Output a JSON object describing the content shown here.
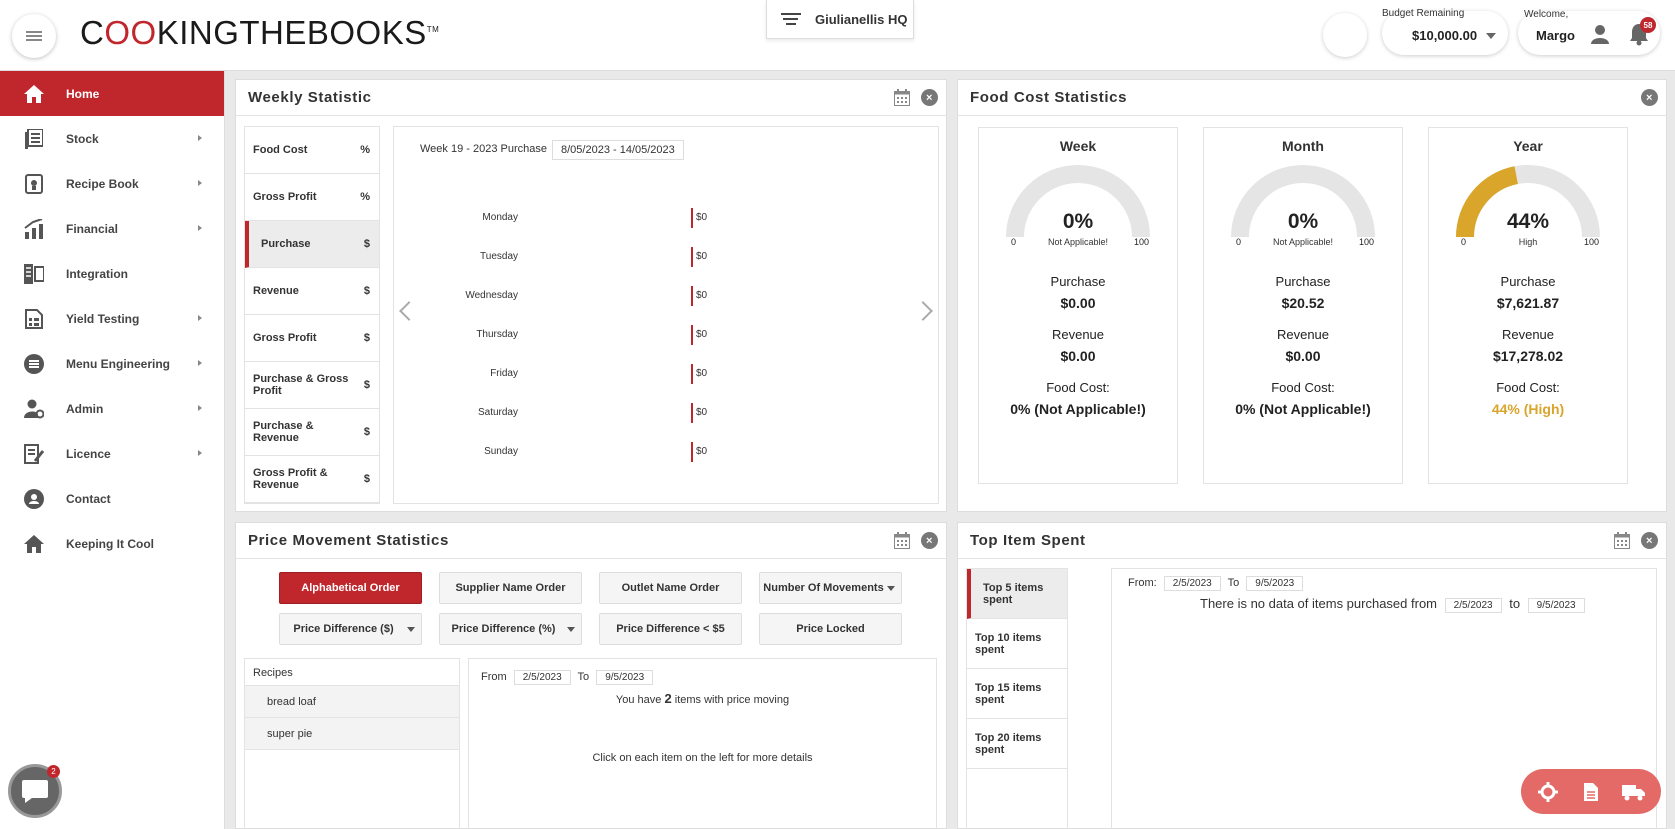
{
  "header": {
    "logo": {
      "pre": "C",
      "o1": "O",
      "o2": "O",
      "post": "KINGTHEBOOKS",
      "tm": "TM"
    },
    "outlet": "Giulianellis HQ",
    "budget_label": "Budget Remaining",
    "budget_amount": "$10,000.00",
    "welcome_label": "Welcome,",
    "user_name": "Margo",
    "notification_count": "58"
  },
  "sidebar": {
    "items": [
      {
        "label": "Home",
        "icon": "home-icon",
        "active": true,
        "arrow": false
      },
      {
        "label": "Stock",
        "icon": "stock-icon",
        "arrow": true
      },
      {
        "label": "Recipe Book",
        "icon": "recipe-book-icon",
        "arrow": true
      },
      {
        "label": "Financial",
        "icon": "financial-icon",
        "arrow": true
      },
      {
        "label": "Integration",
        "icon": "integration-icon",
        "arrow": false
      },
      {
        "label": "Yield Testing",
        "icon": "yield-testing-icon",
        "arrow": true
      },
      {
        "label": "Menu Engineering",
        "icon": "menu-engineering-icon",
        "arrow": true
      },
      {
        "label": "Admin",
        "icon": "admin-icon",
        "arrow": true
      },
      {
        "label": "Licence",
        "icon": "licence-icon",
        "arrow": true
      },
      {
        "label": "Contact",
        "icon": "contact-icon",
        "arrow": false
      },
      {
        "label": "Keeping It Cool",
        "icon": "keeping-cool-icon",
        "arrow": false
      }
    ]
  },
  "weekly": {
    "title": "Weekly Statistic",
    "tabs": [
      {
        "label": "Food Cost",
        "unit": "%"
      },
      {
        "label": "Gross Profit",
        "unit": "%"
      },
      {
        "label": "Purchase",
        "unit": "$",
        "active": true
      },
      {
        "label": "Revenue",
        "unit": "$"
      },
      {
        "label": "Gross Profit",
        "unit": "$"
      },
      {
        "label": "Purchase & Gross Profit",
        "unit": "$"
      },
      {
        "label": "Purchase & Revenue",
        "unit": "$"
      },
      {
        "label": "Gross Profit & Revenue",
        "unit": "$"
      }
    ],
    "chart_title": "Week 19 - 2023 Purchase",
    "chart_range": "8/05/2023 - 14/05/2023",
    "days": [
      {
        "day": "Monday",
        "value": "$0"
      },
      {
        "day": "Tuesday",
        "value": "$0"
      },
      {
        "day": "Wednesday",
        "value": "$0"
      },
      {
        "day": "Thursday",
        "value": "$0"
      },
      {
        "day": "Friday",
        "value": "$0"
      },
      {
        "day": "Saturday",
        "value": "$0"
      },
      {
        "day": "Sunday",
        "value": "$0"
      }
    ]
  },
  "food_cost": {
    "title": "Food Cost Statistics",
    "cards": [
      {
        "period": "Week",
        "pct": "0%",
        "fill": 0,
        "status": "Not Applicable!",
        "min": "0",
        "max": "100",
        "purchase_label": "Purchase",
        "purchase": "$0.00",
        "revenue_label": "Revenue",
        "revenue": "$0.00",
        "fc_label": "Food Cost:",
        "fc_value": "0% (Not Applicable!)",
        "color": "#222222"
      },
      {
        "period": "Month",
        "pct": "0%",
        "fill": 0,
        "status": "Not Applicable!",
        "min": "0",
        "max": "100",
        "purchase_label": "Purchase",
        "purchase": "$20.52",
        "revenue_label": "Revenue",
        "revenue": "$0.00",
        "fc_label": "Food Cost:",
        "fc_value": "0% (Not Applicable!)",
        "color": "#222222"
      },
      {
        "period": "Year",
        "pct": "44%",
        "fill": 44,
        "status": "High",
        "min": "0",
        "max": "100",
        "purchase_label": "Purchase",
        "purchase": "$7,621.87",
        "revenue_label": "Revenue",
        "revenue": "$17,278.02",
        "fc_label": "Food Cost:",
        "fc_value": "44% (High)",
        "color": "#d9a52b"
      }
    ]
  },
  "price_movement": {
    "title": "Price Movement Statistics",
    "buttons_row1": [
      {
        "label": "Alphabetical Order",
        "active": true
      },
      {
        "label": "Supplier Name Order"
      },
      {
        "label": "Outlet Name Order"
      },
      {
        "label": "Number Of Movements",
        "dropdown": true
      }
    ],
    "buttons_row2": [
      {
        "label": "Price Difference ($)",
        "dropdown": true
      },
      {
        "label": "Price Difference (%)",
        "dropdown": true
      },
      {
        "label": "Price Difference < $5"
      },
      {
        "label": "Price Locked"
      }
    ],
    "recipes_header": "Recipes",
    "recipes": [
      "bread loaf",
      "super pie"
    ],
    "from_label": "From",
    "from_date": "2/5/2023",
    "to_label": "To",
    "to_date": "9/5/2023",
    "count_pre": "You have",
    "count": "2",
    "count_post": "items with price moving",
    "hint": "Click on each item on the left for more details"
  },
  "top_item": {
    "title": "Top Item Spent",
    "tabs": [
      "Top 5 items spent",
      "Top 10 items spent",
      "Top 15 items spent",
      "Top 20 items spent"
    ],
    "from_label": "From:",
    "from_date": "2/5/2023",
    "to_label": "To",
    "to_date": "9/5/2023",
    "no_data": "There is no data of items purchased from",
    "no_data_to": "to"
  },
  "chat_badge": "2",
  "colors": {
    "brand_red": "#c0272d",
    "gauge_high": "#d9a52b",
    "gauge_bg": "#e5e5e5"
  }
}
